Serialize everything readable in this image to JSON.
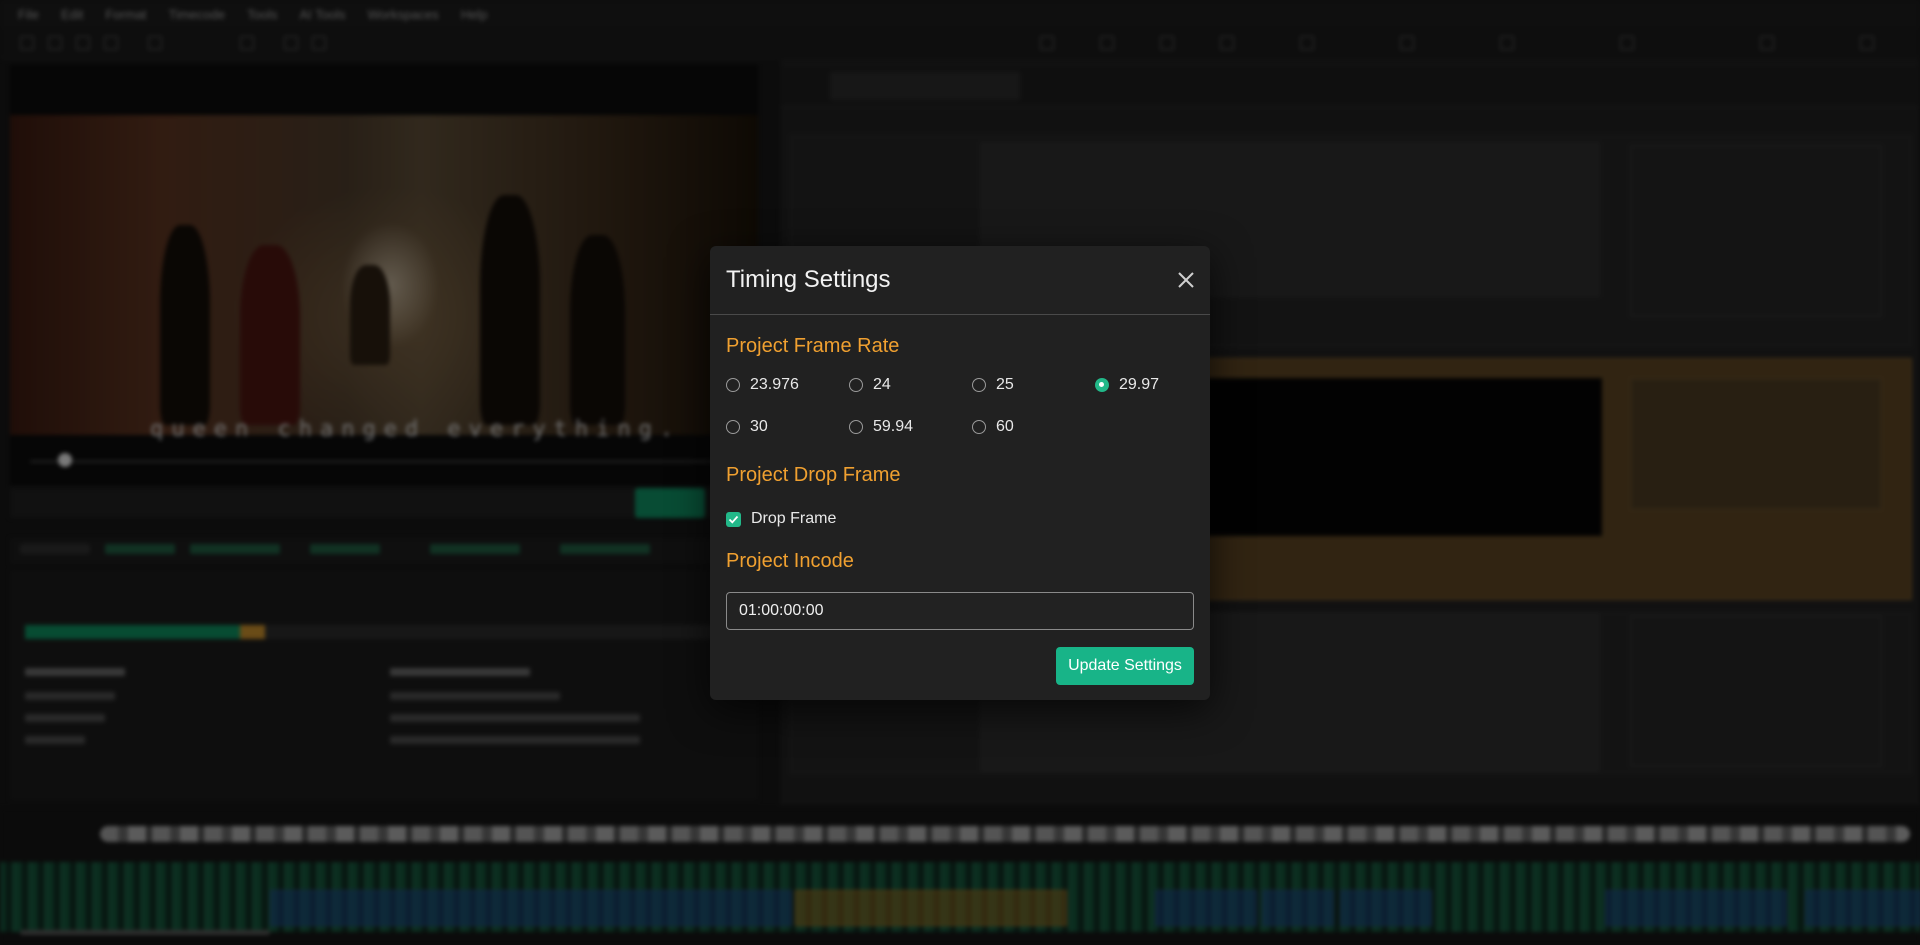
{
  "menu": {
    "items": [
      "File",
      "Edit",
      "Format",
      "Timecode",
      "Tools",
      "AI Tools",
      "Workspaces",
      "Help"
    ]
  },
  "video": {
    "subtitle_overlay": "queen changed everything."
  },
  "modal": {
    "title": "Timing Settings",
    "frame_rate": {
      "heading": "Project Frame Rate",
      "options": [
        "23.976",
        "24",
        "25",
        "29.97",
        "30",
        "59.94",
        "60"
      ],
      "selected": "29.97"
    },
    "drop_frame": {
      "heading": "Project Drop Frame",
      "label": "Drop Frame",
      "checked": true
    },
    "incode": {
      "heading": "Project Incode",
      "value": "01:00:00:00"
    },
    "update_button": "Update Settings"
  },
  "colors": {
    "accent": "#18b488",
    "section_heading": "#f0a030",
    "modal_bg": "#212121"
  }
}
